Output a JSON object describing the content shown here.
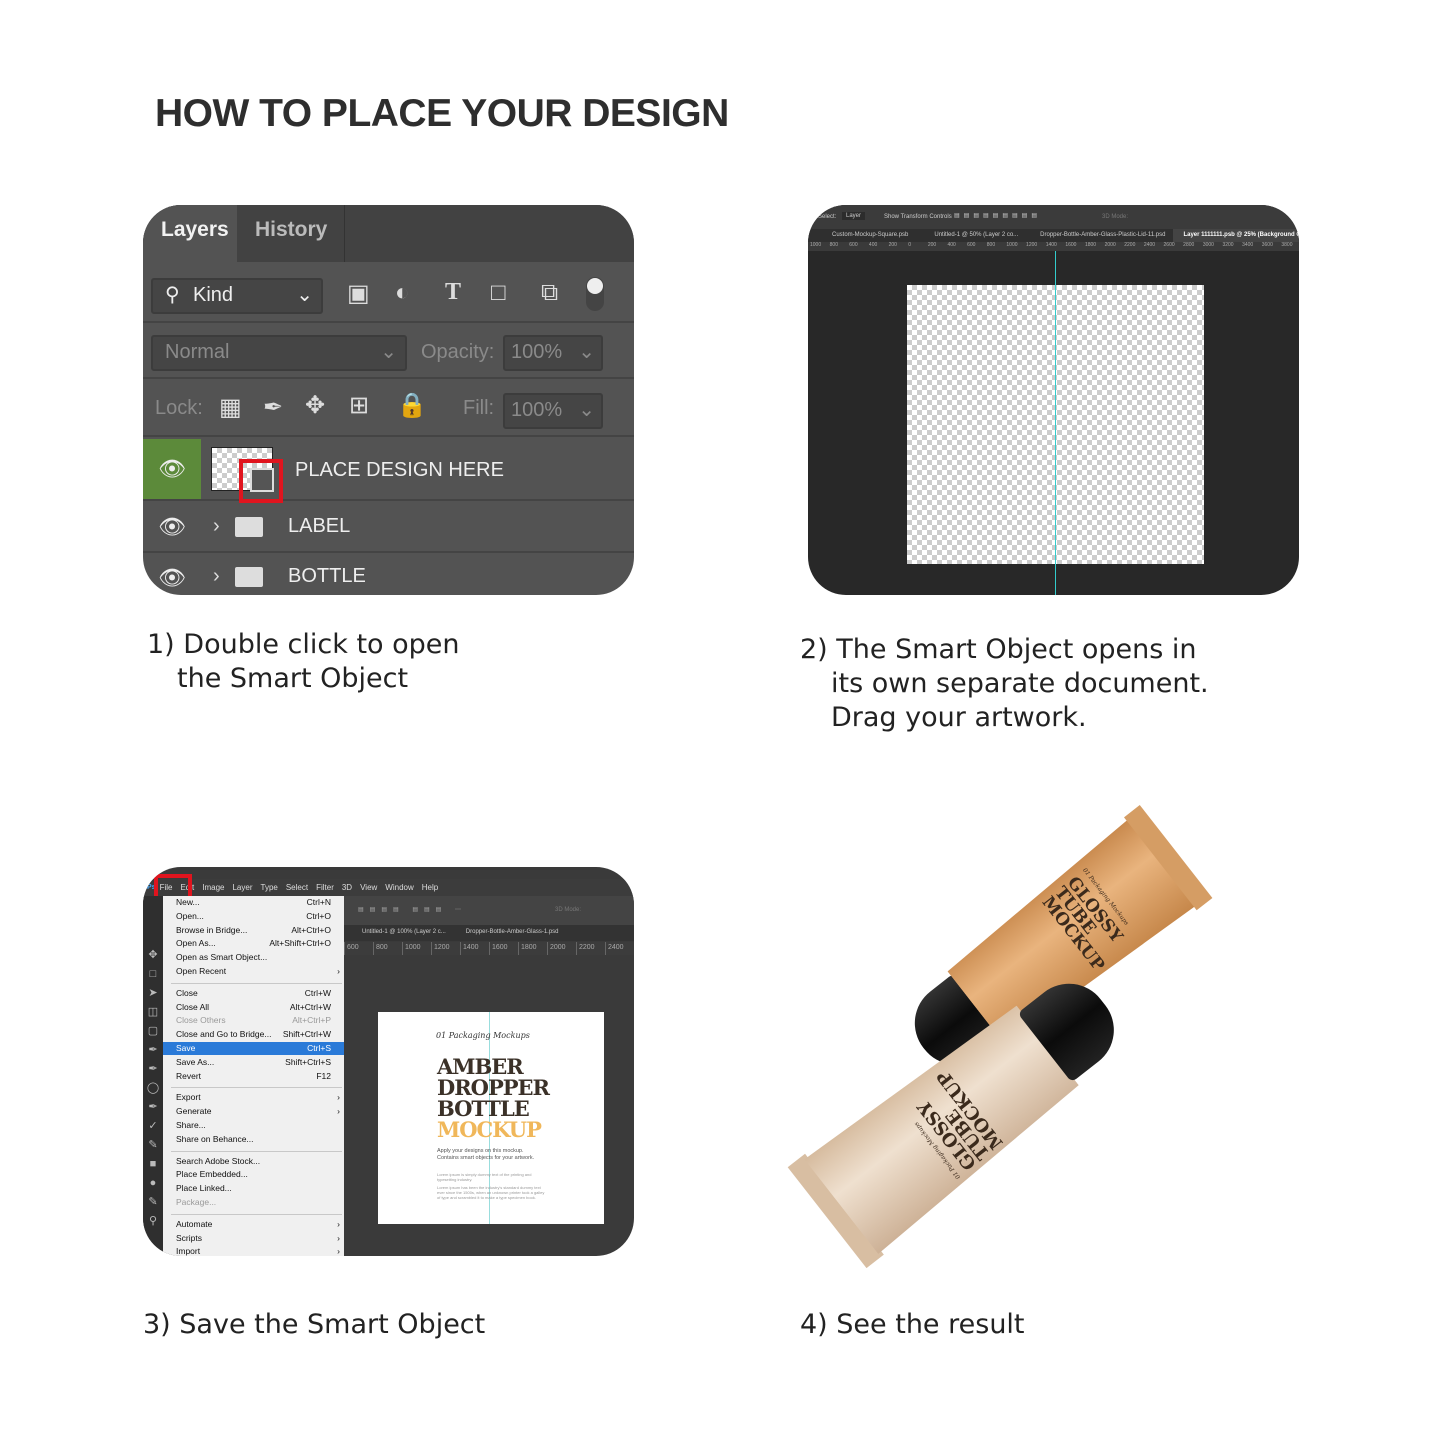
{
  "title": "HOW TO PLACE YOUR DESIGN",
  "steps": [
    {
      "line1": "1) Double click to open",
      "line2": "the Smart Object"
    },
    {
      "line1": "2) The Smart Object opens in",
      "line2": "its own separate document.",
      "line3": "Drag your artwork."
    },
    {
      "line1": "3) Save the Smart Object"
    },
    {
      "line1": "4) See the result"
    }
  ],
  "layers_panel": {
    "tabs": [
      "Layers",
      "History"
    ],
    "filter": "Kind",
    "blend_mode": "Normal",
    "opacity_label": "Opacity:",
    "opacity": "100%",
    "lock_label": "Lock:",
    "fill_label": "Fill:",
    "fill": "100%",
    "layers": [
      {
        "name": "PLACE DESIGN HERE",
        "type": "smart-object"
      },
      {
        "name": "LABEL",
        "type": "group"
      },
      {
        "name": "BOTTLE",
        "type": "group"
      }
    ],
    "highlight_color": "#e0141e",
    "eye_active_color": "#5c8a3a"
  },
  "smart_doc": {
    "options": {
      "select_label": "Select:",
      "select_value": "Layer",
      "transform": "Show Transform Controls",
      "mode": "3D Mode:"
    },
    "tabs": [
      "Custom-Mockup-Square.psb",
      "Untitled-1 @ 50% (Layer 2 co...",
      "Dropper-Bottle-Amber-Glass-Plastic-Lid-11.psd",
      "Layer 1111111.psb @ 25% (Background Color, RG"
    ],
    "ruler": [
      "1000",
      "800",
      "600",
      "400",
      "200",
      "0",
      "200",
      "400",
      "600",
      "800",
      "1000",
      "1200",
      "1400",
      "1600",
      "1800",
      "2000",
      "2200",
      "2400",
      "2600",
      "2800",
      "3000",
      "3200",
      "3400",
      "3600",
      "3800"
    ]
  },
  "save_screen": {
    "menubar": [
      "File",
      "Edit",
      "Image",
      "Layer",
      "Type",
      "Select",
      "Filter",
      "3D",
      "View",
      "Window",
      "Help"
    ],
    "tabs": [
      "Untitled-1 @ 100% (Layer 2 c...",
      "Dropper-Bottle-Amber-Glass-1.psd"
    ],
    "mode": "3D Mode:",
    "ruler": [
      "600",
      "800",
      "1000",
      "1200",
      "1400",
      "1600",
      "1800",
      "2000",
      "2200",
      "2400"
    ],
    "menu": [
      {
        "label": "New...",
        "shortcut": "Ctrl+N"
      },
      {
        "label": "Open...",
        "shortcut": "Ctrl+O"
      },
      {
        "label": "Browse in Bridge...",
        "shortcut": "Alt+Ctrl+O"
      },
      {
        "label": "Open As...",
        "shortcut": "Alt+Shift+Ctrl+O"
      },
      {
        "label": "Open as Smart Object..."
      },
      {
        "label": "Open Recent",
        "submenu": true
      },
      {
        "separator": true
      },
      {
        "label": "Close",
        "shortcut": "Ctrl+W"
      },
      {
        "label": "Close All",
        "shortcut": "Alt+Ctrl+W"
      },
      {
        "label": "Close Others",
        "shortcut": "Alt+Ctrl+P",
        "disabled": true
      },
      {
        "label": "Close and Go to Bridge...",
        "shortcut": "Shift+Ctrl+W"
      },
      {
        "label": "Save",
        "shortcut": "Ctrl+S",
        "highlighted": true
      },
      {
        "label": "Save As...",
        "shortcut": "Shift+Ctrl+S"
      },
      {
        "label": "Revert",
        "shortcut": "F12"
      },
      {
        "separator": true
      },
      {
        "label": "Export",
        "submenu": true
      },
      {
        "label": "Generate",
        "submenu": true
      },
      {
        "label": "Share..."
      },
      {
        "label": "Share on Behance..."
      },
      {
        "separator": true
      },
      {
        "label": "Search Adobe Stock..."
      },
      {
        "label": "Place Embedded..."
      },
      {
        "label": "Place Linked..."
      },
      {
        "label": "Package...",
        "disabled": true
      },
      {
        "separator": true
      },
      {
        "label": "Automate",
        "submenu": true
      },
      {
        "label": "Scripts",
        "submenu": true
      },
      {
        "label": "Import",
        "submenu": true
      }
    ],
    "doc": {
      "script": "01 Packaging Mockups",
      "title_lines": [
        "AMBER",
        "DROPPER",
        "BOTTLE"
      ],
      "accent_line": "MOCKUP",
      "accent_color": "#f0b75a",
      "tagline1": "Apply your designs on this mockup.",
      "tagline2": "Contains smart objects for your artwork.",
      "body1": "Lorem ipsum is simply dummy text of the printing and typesetting industry.",
      "body2": "Lorem ipsum has been the industry's standard dummy text ever since the 1500s, when an unknown printer took a galley of type and scrambled it to make a type specimen book."
    }
  },
  "result": {
    "tubes": [
      {
        "script": "01 Packaging Mockups",
        "lines": [
          "GLOSSY",
          "TUBE",
          "MOCKUP"
        ],
        "color": "#d79a5f"
      },
      {
        "script": "01 Packaging Mockups",
        "lines": [
          "GLOSSY",
          "TUBE",
          "MOCKUP"
        ],
        "color": "#e0c8ae"
      }
    ]
  }
}
